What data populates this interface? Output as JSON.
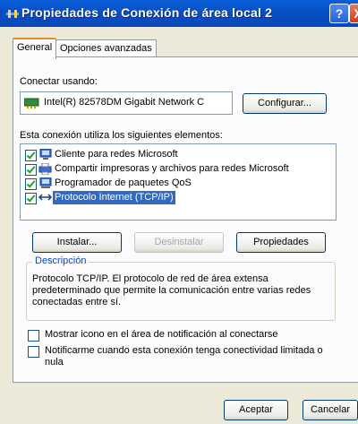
{
  "window": {
    "title": "Propiedades de Conexión de área local 2",
    "help_label": "?",
    "close_label": "X"
  },
  "tabs": [
    {
      "label": "General",
      "active": true
    },
    {
      "label": "Opciones avanzadas",
      "active": false
    }
  ],
  "connect_using": {
    "label": "Conectar usando:",
    "device": "Intel(R) 82578DM Gigabit Network C",
    "configure_button": "Configurar..."
  },
  "components": {
    "label": "Esta conexión utiliza los siguientes elementos:",
    "items": [
      {
        "label": "Cliente para redes Microsoft",
        "checked": true,
        "icon": "network-client-icon"
      },
      {
        "label": "Compartir impresoras y archivos para redes Microsoft",
        "checked": true,
        "icon": "file-printer-sharing-icon"
      },
      {
        "label": "Programador de paquetes QoS",
        "checked": true,
        "icon": "qos-scheduler-icon"
      },
      {
        "label": "Protocolo Internet (TCP/IP)",
        "checked": true,
        "selected": true,
        "icon": "protocol-icon"
      }
    ]
  },
  "buttons": {
    "install": "Instalar...",
    "uninstall": "Desinstalar",
    "properties": "Propiedades",
    "accept": "Aceptar",
    "cancel": "Cancelar"
  },
  "description": {
    "title": "Descripción",
    "text": "Protocolo TCP/IP. El protocolo de red de área extensa predeterminado que permite la comunicación entre varias redes conectadas entre sí."
  },
  "options": [
    {
      "label": "Mostrar icono en el área de notificación al conectarse",
      "checked": false
    },
    {
      "label": "Notificarme cuando esta conexión tenga conectividad limitada o nula",
      "checked": false
    }
  ],
  "colors": {
    "titlebar": "#0850c6",
    "selection": "#316ac5",
    "dialog_bg": "#ece9d8",
    "group_title": "#0046d5"
  }
}
